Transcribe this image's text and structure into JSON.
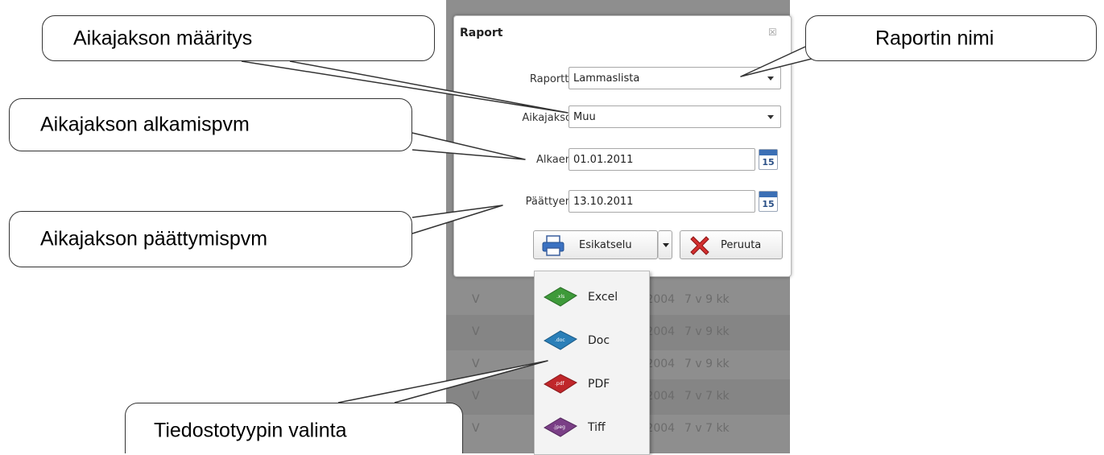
{
  "background_rows": [
    {
      "c1": "V",
      "c2": "",
      "c3": ".2004",
      "c4": "7 v 9 kk"
    },
    {
      "c1": "V",
      "c2": "",
      "c3": ".2004",
      "c4": "7 v 9 kk"
    },
    {
      "c1": "V",
      "c2": "",
      "c3": ".2004",
      "c4": "7 v 9 kk"
    },
    {
      "c1": "V",
      "c2": "",
      "c3": ".2004",
      "c4": "7 v 7 kk"
    },
    {
      "c1": "V",
      "c2": "",
      "c3": ".2004",
      "c4": "7 v 7 kk"
    }
  ],
  "dialog": {
    "title": "Raport",
    "close_glyph": "☒",
    "fields": {
      "report_label": "Raportti",
      "report_value": "Lammaslista",
      "period_label": "Aikajakso",
      "period_value": "Muu",
      "start_label": "Alkaen",
      "start_value": "01.01.2011",
      "end_label": "Päättyen",
      "end_value": "13.10.2011",
      "calendar_day": "15"
    },
    "buttons": {
      "preview_label": "Esikatselu",
      "cancel_label": "Peruuta"
    }
  },
  "menu": {
    "items": [
      {
        "label": "Excel",
        "icon": "xls-file-icon",
        "color": "#3e9a3a",
        "tag": ".xls"
      },
      {
        "label": "Doc",
        "icon": "doc-file-icon",
        "color": "#2a7fb8",
        "tag": ".doc"
      },
      {
        "label": "PDF",
        "icon": "pdf-file-icon",
        "color": "#c0262a",
        "tag": ".pdf"
      },
      {
        "label": "Tiff",
        "icon": "tiff-file-icon",
        "color": "#7a3f86",
        "tag": ".jpeg"
      }
    ]
  },
  "callouts": {
    "period_definition": "Aikajakson määritys",
    "report_name": "Raportin nimi",
    "start_date": "Aikajakson alkamispvm",
    "end_date": "Aikajakson päättymispvm",
    "file_type": "Tiedostotyypin valinta"
  }
}
